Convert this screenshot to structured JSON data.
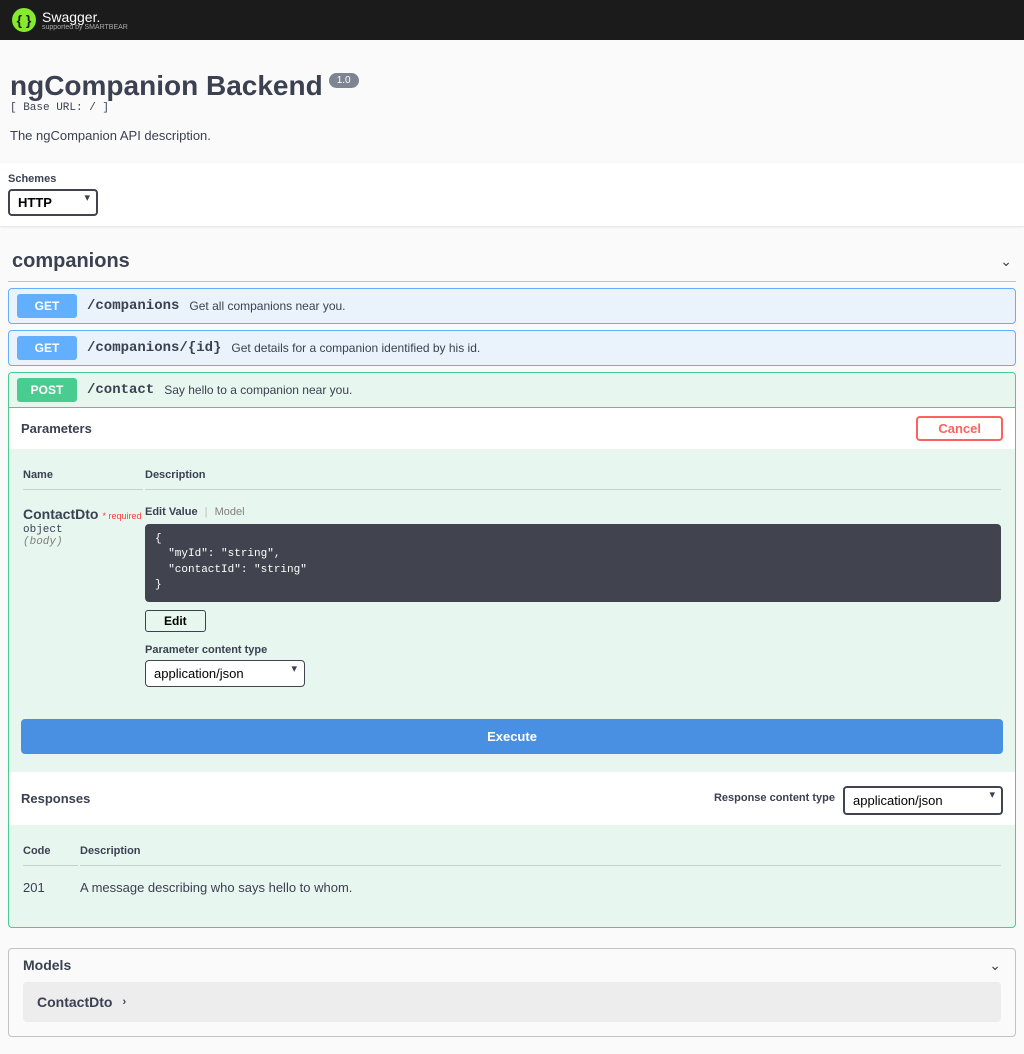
{
  "header": {
    "brand": "Swagger.",
    "sub_brand": "supported by SMARTBEAR"
  },
  "info": {
    "title": "ngCompanion Backend",
    "version": "1.0",
    "base_url_label": "[ Base URL: / ]",
    "description": "The ngCompanion API description."
  },
  "schemes": {
    "label": "Schemes",
    "selected": "HTTP"
  },
  "tag": {
    "name": "companions",
    "operations": [
      {
        "method": "GET",
        "path": "/companions",
        "summary": "Get all companions near you."
      },
      {
        "method": "GET",
        "path": "/companions/{id}",
        "summary": "Get details for a companion identified by his id."
      }
    ],
    "expanded_op": {
      "method": "POST",
      "path": "/contact",
      "summary": "Say hello to a companion near you.",
      "parameters_title": "Parameters",
      "cancel_label": "Cancel",
      "columns": {
        "name": "Name",
        "desc": "Description"
      },
      "param": {
        "name": "ContactDto",
        "required_text": "* required",
        "type": "object",
        "in": "(body)",
        "tabs": {
          "edit_value": "Edit Value",
          "model": "Model"
        },
        "example": "{\n  \"myId\": \"string\",\n  \"contactId\": \"string\"\n}",
        "edit_btn": "Edit",
        "content_type_label": "Parameter content type",
        "content_type": "application/json"
      },
      "execute_label": "Execute",
      "responses": {
        "title": "Responses",
        "content_type_label": "Response content type",
        "content_type": "application/json",
        "columns": {
          "code": "Code",
          "desc": "Description"
        },
        "rows": [
          {
            "code": "201",
            "desc": "A message describing who says hello to whom."
          }
        ]
      }
    }
  },
  "models": {
    "title": "Models",
    "items": [
      {
        "name": "ContactDto"
      }
    ]
  }
}
